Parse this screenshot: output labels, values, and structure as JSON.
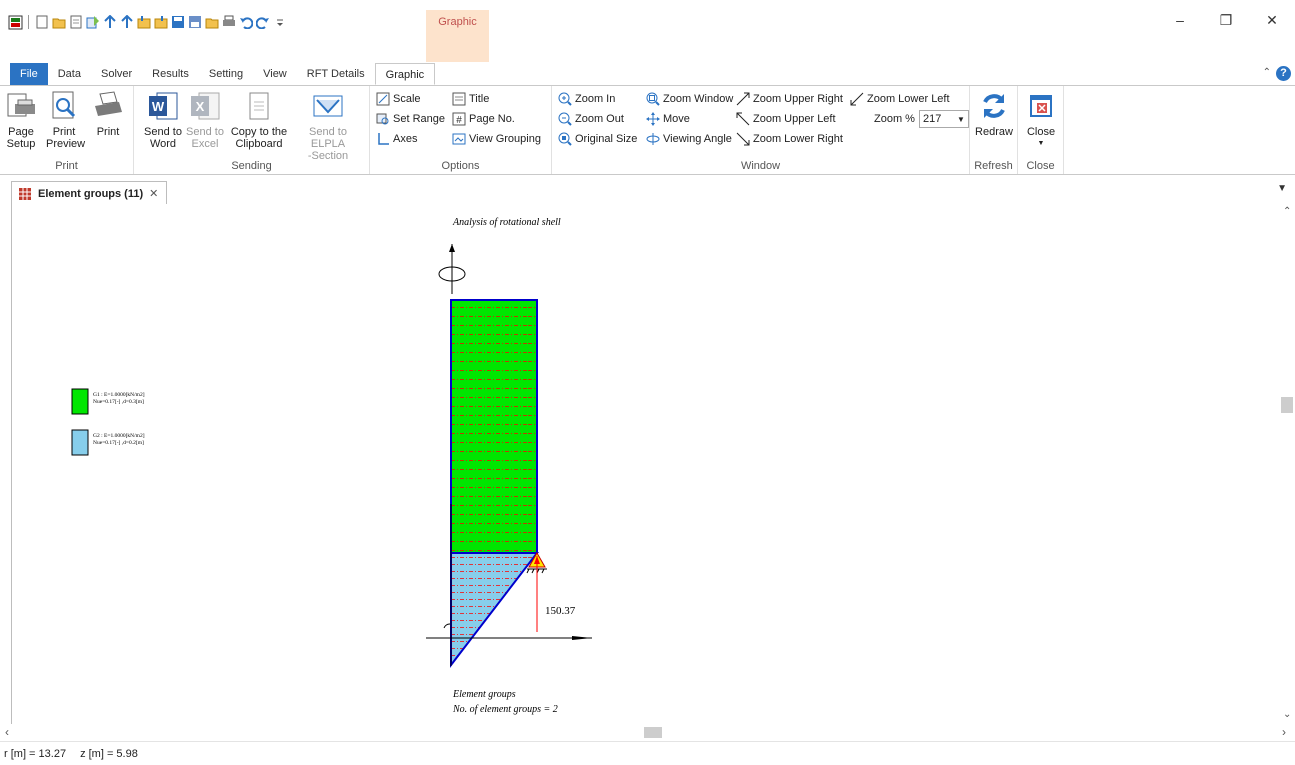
{
  "quick_access": {
    "icons": [
      "app-icon",
      "new-icon",
      "open-icon",
      "new-file-icon",
      "import-icon",
      "export-icon",
      "export2-icon",
      "data-icon",
      "data2-icon",
      "save-icon",
      "save-as-icon",
      "folder-icon",
      "print-icon",
      "undo-icon",
      "redo-icon",
      "customize-icon"
    ]
  },
  "context_group_label": "Graphic",
  "tabs": [
    "File",
    "Data",
    "Solver",
    "Results",
    "Setting",
    "View",
    "RFT Details",
    "Graphic"
  ],
  "active_tab": "Graphic",
  "ribbon": {
    "print": {
      "label": "Print",
      "page_setup": "Page\nSetup",
      "print_preview": "Print\nPreview",
      "print": "Print"
    },
    "sending": {
      "label": "Sending",
      "send_to_word": "Send to\nWord",
      "send_to_excel": "Send to\nExcel",
      "copy_to_clipboard": "Copy to the\nClipboard",
      "send_to_elpla": "Send to ELPLA\n-Section"
    },
    "options": {
      "label": "Options",
      "scale": "Scale",
      "set_range": "Set Range",
      "axes": "Axes",
      "title": "Title",
      "page_no": "Page No.",
      "view_grouping": "View Grouping"
    },
    "window": {
      "label": "Window",
      "zoom_in": "Zoom In",
      "zoom_out": "Zoom Out",
      "original_size": "Original Size",
      "zoom_window": "Zoom Window",
      "move": "Move",
      "viewing_angle": "Viewing Angle",
      "zoom_upper_right": "Zoom Upper Right",
      "zoom_upper_left": "Zoom Upper Left",
      "zoom_lower_right": "Zoom Lower Right",
      "zoom_lower_left": "Zoom Lower Left",
      "zoom_percent_label": "Zoom %",
      "zoom_percent_value": "217"
    },
    "refresh": {
      "label": "Refresh",
      "redraw": "Redraw"
    },
    "close": {
      "label": "Close",
      "close": "Close"
    }
  },
  "document_tab": {
    "title": "Element groups (11)",
    "close": "✕"
  },
  "drawing": {
    "title": "Analysis of rotational shell",
    "legend": [
      {
        "line1": "G1 : E=1.0000[kN/m2]",
        "line2": "Nue=0.17[-] ,d=0.3[m]",
        "color": "#00e600"
      },
      {
        "line1": "G2 : E=1.0000[kN/m2]",
        "line2": "Nue=0.17[-] ,d=0.2[m]",
        "color": "#87ceeb"
      }
    ],
    "reaction_value": "150.37",
    "footer_line1": "Element groups",
    "footer_line2": "No. of element groups = 2"
  },
  "status": {
    "r": "r [m] = 13.27",
    "z": "z [m] = 5.98"
  },
  "colors": {
    "file_tab": "#2b73c3",
    "context_tab_bg": "#fde3cc",
    "context_tab_text": "#c0504d",
    "group1_fill": "#00e600",
    "group2_fill": "#87ceeb",
    "mesh_line": "#ff0000",
    "outline": "#0000cc"
  }
}
